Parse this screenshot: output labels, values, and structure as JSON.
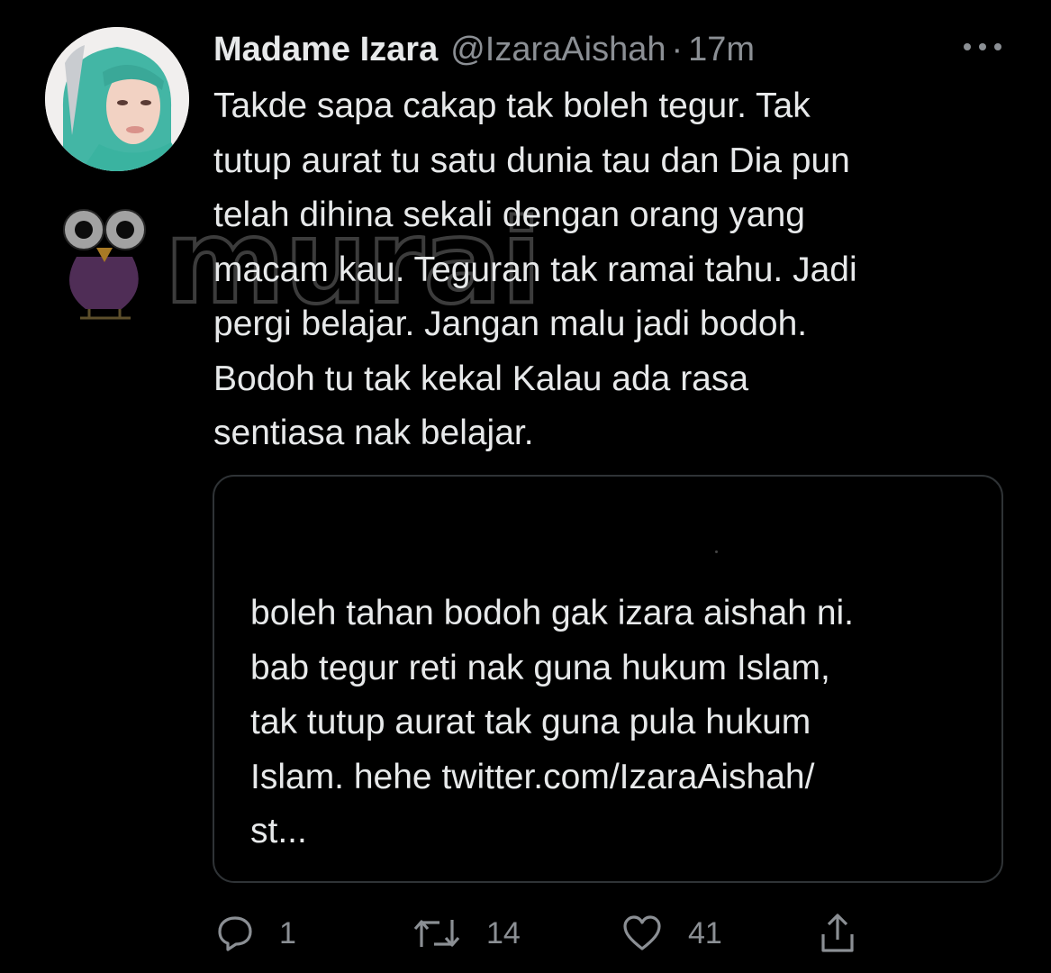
{
  "tweet": {
    "display_name": "Madame Izara",
    "handle": "@IzaraAishah",
    "separator": "·",
    "time": "17m",
    "text": "Takde sapa cakap tak boleh tegur. Tak\ntutup aurat tu satu dunia tau dan Dia pun\ntelah dihina sekali dengan orang yang\nmacam kau. Teguran tak ramai tahu. Jadi\npergi belajar. Jangan malu jadi bodoh.\nBodoh tu tak kekal Kalau ada rasa\nsentiasa nak belajar."
  },
  "quoted_tweet": {
    "text": "boleh tahan bodoh gak izara aishah ni.\nbab tegur reti nak guna hukum Islam,\ntak tutup aurat tak guna pula hukum\nIslam. hehe twitter.com/IzaraAishah/\nst..."
  },
  "actions": {
    "reply_count": "1",
    "retweet_count": "14",
    "like_count": "41"
  },
  "watermark": {
    "text": "murai"
  },
  "icons": {
    "more": "more-horizontal-icon",
    "reply": "reply-icon",
    "retweet": "retweet-icon",
    "like": "heart-icon",
    "share": "share-icon",
    "watermark_owl": "owl-logo-icon"
  },
  "colors": {
    "background": "#000000",
    "text_primary": "#e7e9ea",
    "text_secondary": "#8b8f94",
    "border": "#2f3336"
  }
}
